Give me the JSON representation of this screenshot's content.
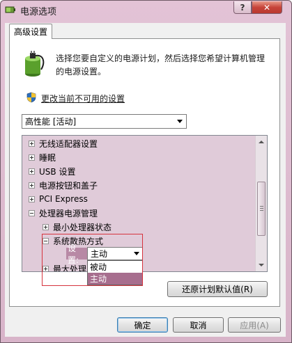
{
  "window": {
    "title": "电源选项",
    "help_label": "?",
    "close_label": "✕"
  },
  "tab": {
    "label": "高级设置"
  },
  "intro": {
    "description": "选择您要自定义的电源计划，然后选择您希望计算机管理的电源设置。",
    "change_link": "更改当前不可用的设置"
  },
  "plan_select": {
    "value": "高性能 [活动]"
  },
  "tree": {
    "items": [
      {
        "label": "无线适配器设置",
        "expander": "+"
      },
      {
        "label": "睡眠",
        "expander": "+"
      },
      {
        "label": "USB 设置",
        "expander": "+"
      },
      {
        "label": "电源按钮和盖子",
        "expander": "+"
      },
      {
        "label": "PCI Express",
        "expander": "+"
      },
      {
        "label": "处理器电源管理",
        "expander": "-"
      },
      {
        "label": "最小处理器状态",
        "expander": "+"
      },
      {
        "label": "系统散热方式",
        "expander": "-"
      },
      {
        "label": "最大处理",
        "expander": "+"
      }
    ],
    "setting_label": "设置:",
    "setting_value": "主动",
    "options": [
      "被动",
      "主动"
    ],
    "selected_option": "主动"
  },
  "buttons": {
    "restore": "还原计划默认值(R)",
    "ok": "确定",
    "cancel": "取消",
    "apply": "应用(A)"
  },
  "colors": {
    "chrome": "#dcbccf",
    "tree_bg": "#e0cbd9",
    "selection": "#a76e8e",
    "highlight_box": "#d6333d",
    "close_button": "#c7443a"
  }
}
